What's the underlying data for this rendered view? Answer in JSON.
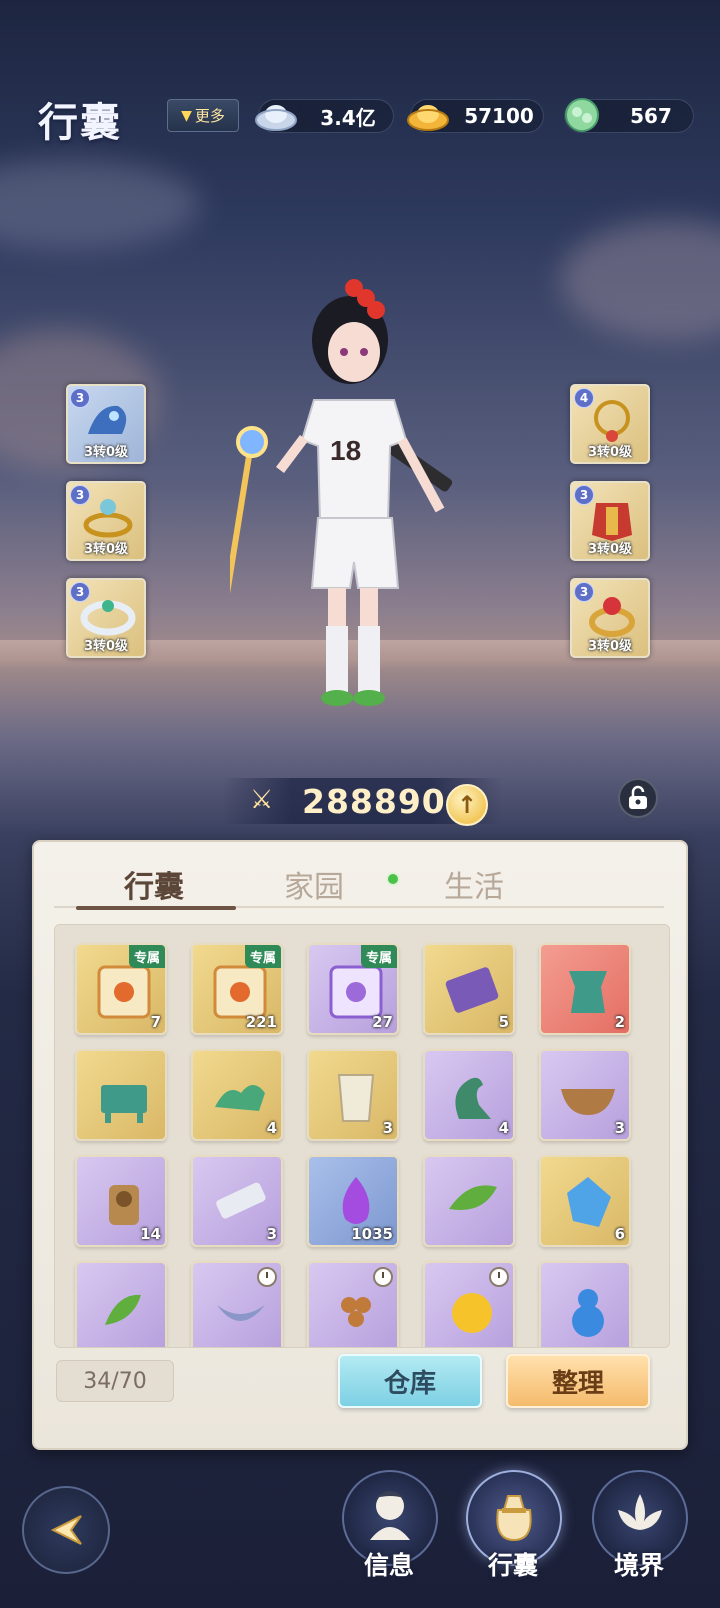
{
  "header": {
    "title": "行囊",
    "more_label": "更多",
    "currencies": [
      {
        "icon": "silver-ingot-icon",
        "value": "3.4亿"
      },
      {
        "icon": "gold-ingot-icon",
        "value": "57100"
      },
      {
        "icon": "jade-token-icon",
        "value": "567"
      }
    ]
  },
  "equipment": {
    "left": [
      {
        "level": "3",
        "label": "3转0级",
        "icon": "bird-helmet-icon"
      },
      {
        "level": "3",
        "label": "3转0级",
        "icon": "ring-ornament-icon"
      },
      {
        "level": "3",
        "label": "3转0级",
        "icon": "bracelet-icon"
      }
    ],
    "right": [
      {
        "level": "4",
        "label": "3转0级",
        "icon": "necklace-icon"
      },
      {
        "level": "3",
        "label": "3转0级",
        "icon": "armor-icon"
      },
      {
        "level": "3",
        "label": "3转0级",
        "icon": "gem-ring-icon"
      }
    ]
  },
  "power": {
    "value": "288890"
  },
  "tabs": [
    "行囊",
    "家园",
    "生活"
  ],
  "items": [
    {
      "icon": "lotus-scroll-icon",
      "rarity": "gold",
      "count": "7",
      "tag": "专属"
    },
    {
      "icon": "lotus-scroll-icon",
      "rarity": "gold",
      "count": "221",
      "tag": "专属"
    },
    {
      "icon": "purple-scroll-icon",
      "rarity": "purple",
      "count": "27",
      "tag": "专属"
    },
    {
      "icon": "ticket-icon",
      "rarity": "gold",
      "count": "5",
      "tag": ""
    },
    {
      "icon": "bronze-vessel-icon",
      "rarity": "red",
      "count": "2",
      "tag": ""
    },
    {
      "icon": "bronze-cauldron-icon",
      "rarity": "gold",
      "count": "",
      "tag": ""
    },
    {
      "icon": "jade-dragon-icon",
      "rarity": "gold",
      "count": "4",
      "tag": ""
    },
    {
      "icon": "jade-cup-icon",
      "rarity": "gold",
      "count": "3",
      "tag": ""
    },
    {
      "icon": "jade-bird-icon",
      "rarity": "purple",
      "count": "4",
      "tag": ""
    },
    {
      "icon": "bronze-bowl-icon",
      "rarity": "purple",
      "count": "3",
      "tag": ""
    },
    {
      "icon": "lantern-statue-icon",
      "rarity": "purple",
      "count": "14",
      "tag": ""
    },
    {
      "icon": "jade-tablet-icon",
      "rarity": "purple",
      "count": "3",
      "tag": ""
    },
    {
      "icon": "purple-flame-icon",
      "rarity": "blue",
      "count": "1035",
      "tag": ""
    },
    {
      "icon": "green-leaf-icon",
      "rarity": "purple",
      "count": "",
      "tag": ""
    },
    {
      "icon": "blue-crystal-icon",
      "rarity": "gold",
      "count": "6",
      "tag": ""
    },
    {
      "icon": "herb-icon",
      "rarity": "purple",
      "count": "",
      "tag": ""
    },
    {
      "icon": "banana-icon",
      "rarity": "purple",
      "count": "",
      "tag": "",
      "timed": true
    },
    {
      "icon": "grape-icon",
      "rarity": "purple",
      "count": "",
      "tag": "",
      "timed": true
    },
    {
      "icon": "golden-apple-icon",
      "rarity": "purple",
      "count": "",
      "tag": "",
      "timed": true
    },
    {
      "icon": "gourd-icon",
      "rarity": "purple",
      "count": "",
      "tag": ""
    }
  ],
  "capacity": "34/70",
  "buttons": {
    "warehouse": "仓库",
    "sort": "整理"
  },
  "nav": [
    {
      "label": "信息",
      "icon": "profile-icon"
    },
    {
      "label": "行囊",
      "icon": "bag-icon"
    },
    {
      "label": "境界",
      "icon": "lotus-icon"
    }
  ],
  "colors": {
    "accent": "#f5bb6d",
    "tab_active": "#5b4638",
    "warehouse": "#7dd0e4"
  }
}
